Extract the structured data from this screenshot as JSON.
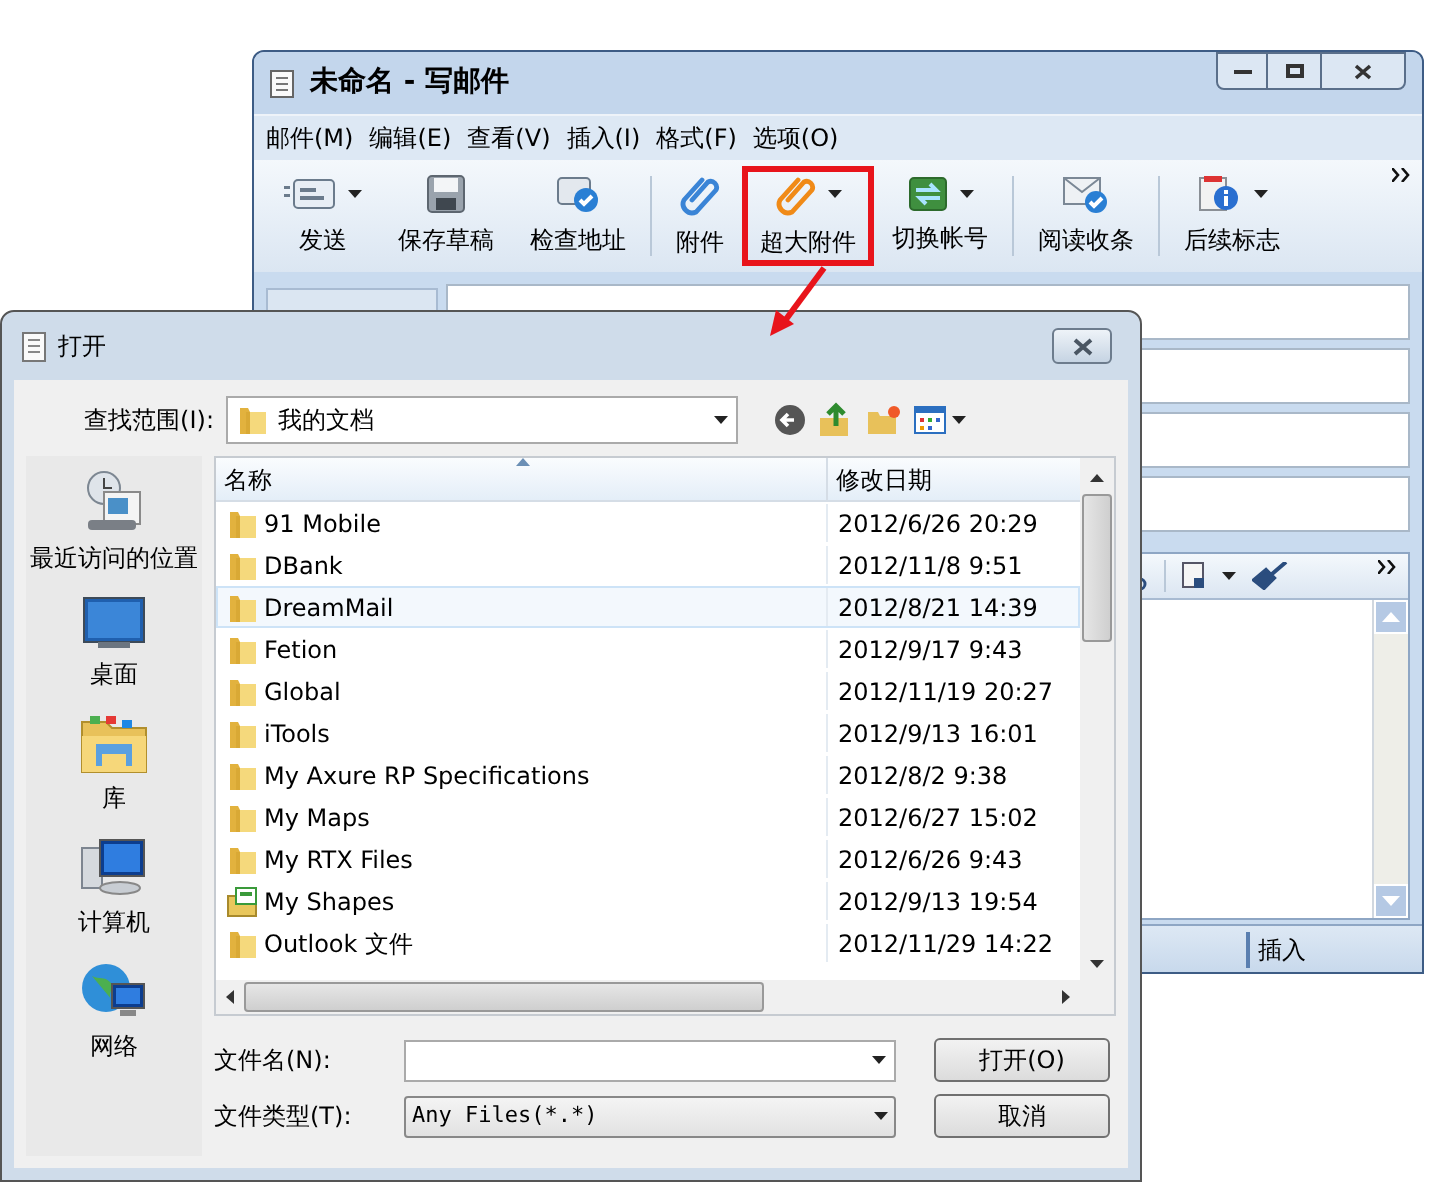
{
  "compose_window": {
    "title": "未命名 - 写邮件",
    "menu": [
      "邮件(M)",
      "编辑(E)",
      "查看(V)",
      "插入(I)",
      "格式(F)",
      "选项(O)"
    ],
    "toolbar": [
      {
        "label": "发送",
        "kind": "send",
        "dropdown": true,
        "highlighted": false
      },
      {
        "label": "保存草稿",
        "kind": "save",
        "dropdown": false,
        "highlighted": false
      },
      {
        "label": "检查地址",
        "kind": "check",
        "dropdown": false,
        "highlighted": false
      },
      {
        "label": "附件",
        "kind": "attach",
        "dropdown": false,
        "highlighted": false
      },
      {
        "label": "超大附件",
        "kind": "bigattach",
        "dropdown": true,
        "highlighted": true
      },
      {
        "label": "切换帐号",
        "kind": "switch",
        "dropdown": true,
        "highlighted": false
      },
      {
        "label": "阅读收条",
        "kind": "receipt",
        "dropdown": false,
        "highlighted": false
      },
      {
        "label": "后续标志",
        "kind": "flag",
        "dropdown": true,
        "highlighted": false
      }
    ],
    "status_bar": "插入"
  },
  "open_dialog": {
    "title": "打开",
    "look_in_label": "查找范围(I):",
    "look_in_value": "我的文档",
    "places": [
      {
        "label": "最近访问的位置",
        "kind": "recent"
      },
      {
        "label": "桌面",
        "kind": "desktop"
      },
      {
        "label": "库",
        "kind": "library"
      },
      {
        "label": "计算机",
        "kind": "computer"
      },
      {
        "label": "网络",
        "kind": "network"
      }
    ],
    "columns": [
      "名称",
      "修改日期"
    ],
    "files": [
      {
        "name": "91 Mobile",
        "modified": "2012/6/26 20:29",
        "kind": "folder",
        "selected": false
      },
      {
        "name": "DBank",
        "modified": "2012/11/8 9:51",
        "kind": "folder",
        "selected": false
      },
      {
        "name": "DreamMail",
        "modified": "2012/8/21 14:39",
        "kind": "folder",
        "selected": true
      },
      {
        "name": "Fetion",
        "modified": "2012/9/17 9:43",
        "kind": "folder",
        "selected": false
      },
      {
        "name": "Global",
        "modified": "2012/11/19 20:27",
        "kind": "folder",
        "selected": false
      },
      {
        "name": "iTools",
        "modified": "2012/9/13 16:01",
        "kind": "folder",
        "selected": false
      },
      {
        "name": "My Axure RP Specifications",
        "modified": "2012/8/2 9:38",
        "kind": "folder",
        "selected": false
      },
      {
        "name": "My Maps",
        "modified": "2012/6/27 15:02",
        "kind": "folder",
        "selected": false
      },
      {
        "name": "My RTX Files",
        "modified": "2012/6/26 9:43",
        "kind": "folder",
        "selected": false
      },
      {
        "name": "My Shapes",
        "modified": "2012/9/13 19:54",
        "kind": "shapes",
        "selected": false
      },
      {
        "name": "Outlook 文件",
        "modified": "2012/11/29 14:22",
        "kind": "folder",
        "selected": false
      }
    ],
    "file_name_label": "文件名(N):",
    "file_type_label": "文件类型(T):",
    "file_type_value": "Any Files(*.*)",
    "buttons": [
      "打开(O)",
      "取消"
    ]
  }
}
